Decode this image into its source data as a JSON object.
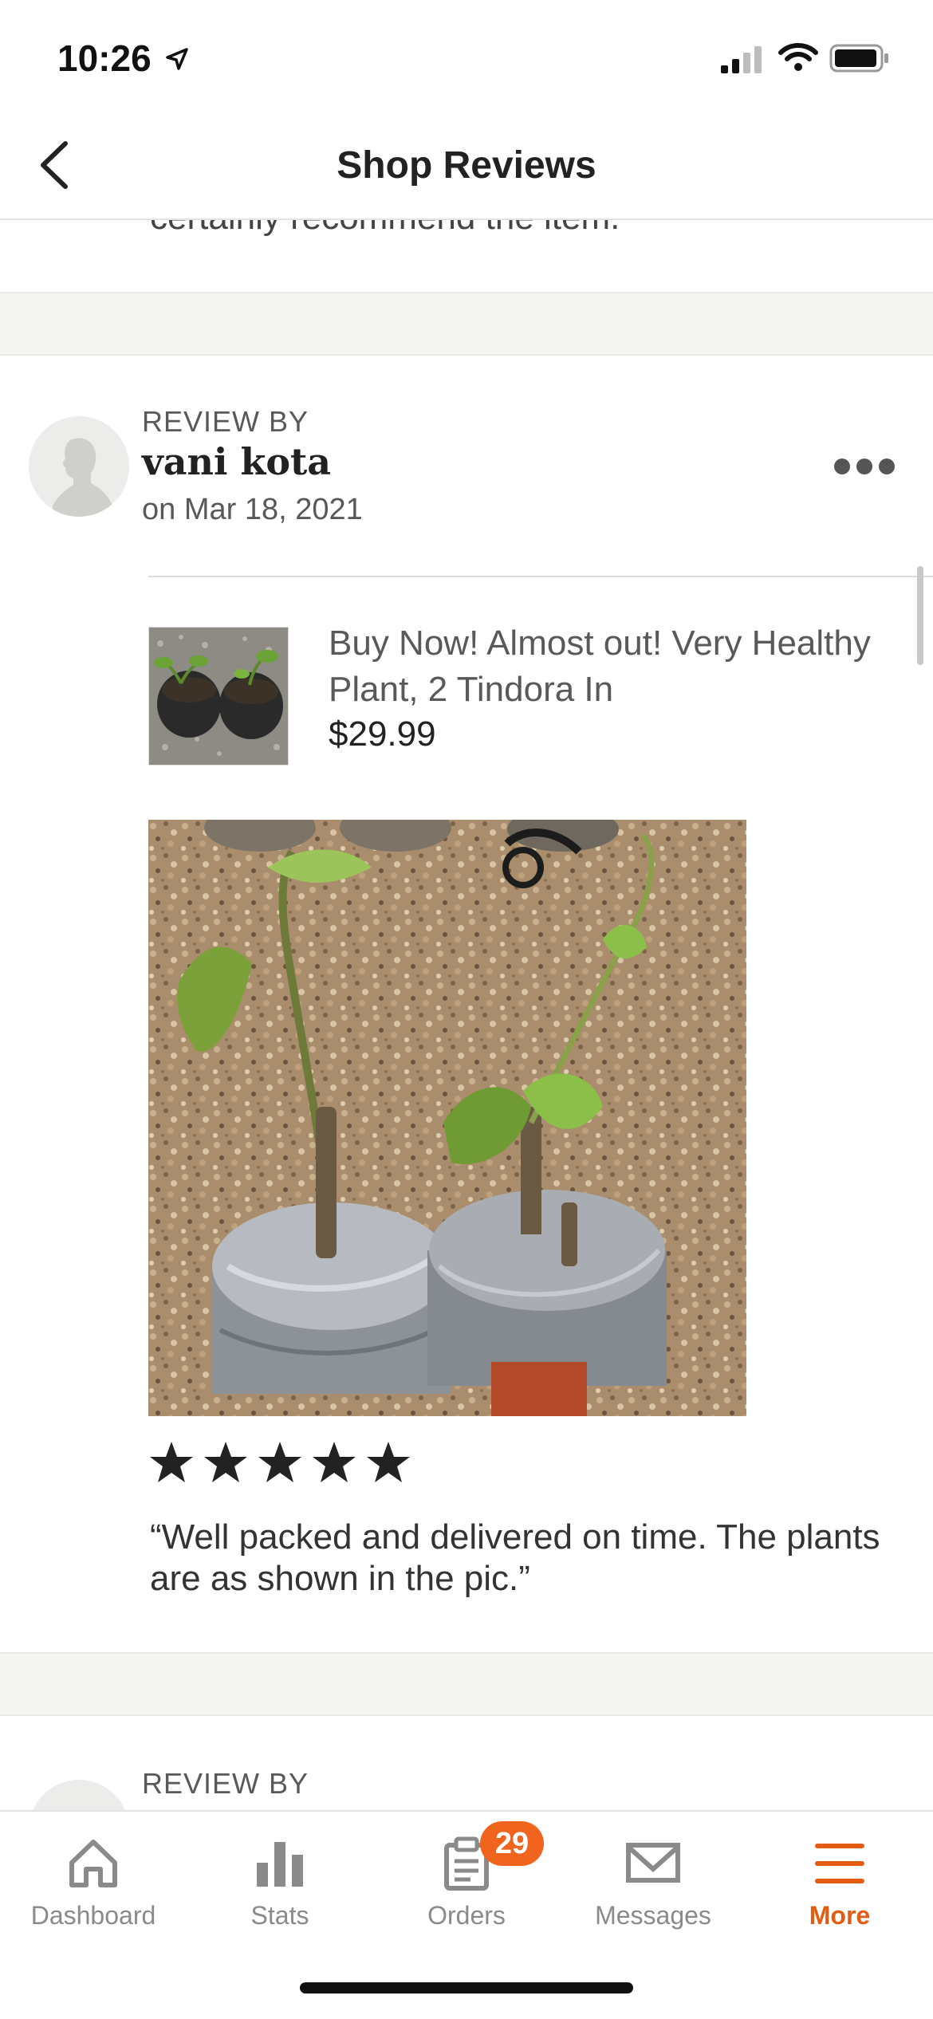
{
  "status_bar": {
    "time": "10:26"
  },
  "header": {
    "title": "Shop Reviews",
    "back_icon": "chevron-left-icon"
  },
  "previous_review": {
    "text_fragment": "certainly recommend the item."
  },
  "review": {
    "label": "REVIEW BY",
    "reviewer_name": "vani kota",
    "date": "on Mar 18, 2021",
    "more_icon": "ellipsis-icon",
    "listing": {
      "title": "Buy Now! Almost out! Very Healthy Plant, 2 Tindora In",
      "price": "$29.99"
    },
    "rating": 5,
    "rating_max": 5,
    "text": "“Well packed and delivered on time.  The plants are as shown in the pic.”"
  },
  "next_review": {
    "label": "REVIEW BY"
  },
  "tab_bar": {
    "tabs": [
      {
        "label": "Dashboard",
        "icon": "home-icon"
      },
      {
        "label": "Stats",
        "icon": "bar-chart-icon"
      },
      {
        "label": "Orders",
        "icon": "clipboard-icon",
        "badge": "29"
      },
      {
        "label": "Messages",
        "icon": "envelope-icon"
      },
      {
        "label": "More",
        "icon": "menu-icon",
        "active": true
      }
    ]
  },
  "colors": {
    "accent": "#f1641e",
    "active_tab": "#e45c12",
    "band": "#f5f5f1"
  }
}
